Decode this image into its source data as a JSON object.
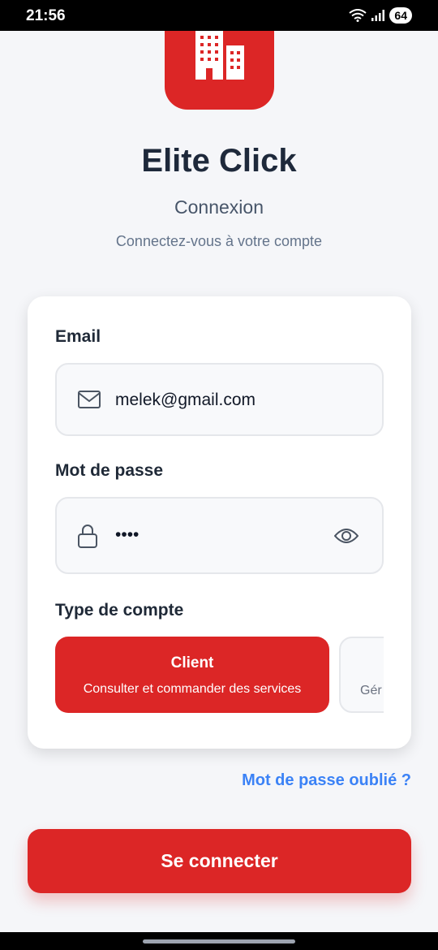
{
  "status_bar": {
    "time": "21:56",
    "battery": "64"
  },
  "app": {
    "title": "Elite Click",
    "subtitle": "Connexion",
    "description": "Connectez-vous à votre compte"
  },
  "form": {
    "email_label": "Email",
    "email_value": "melek@gmail.com",
    "password_label": "Mot de passe",
    "password_value": "••••",
    "account_type_label": "Type de compte",
    "account_types": [
      {
        "title": "Client",
        "description": "Consulter et commander des services",
        "selected": true
      },
      {
        "title": "",
        "description": "Gér",
        "selected": false
      }
    ]
  },
  "forgot_password": "Mot de passe oublié ?",
  "login_button": "Se connecter",
  "colors": {
    "primary": "#dc2626",
    "link": "#3b82f6",
    "background": "#f5f6f9"
  },
  "icons": [
    "building-icon",
    "mail-icon",
    "lock-icon",
    "eye-icon",
    "wifi-icon",
    "signal-icon"
  ]
}
